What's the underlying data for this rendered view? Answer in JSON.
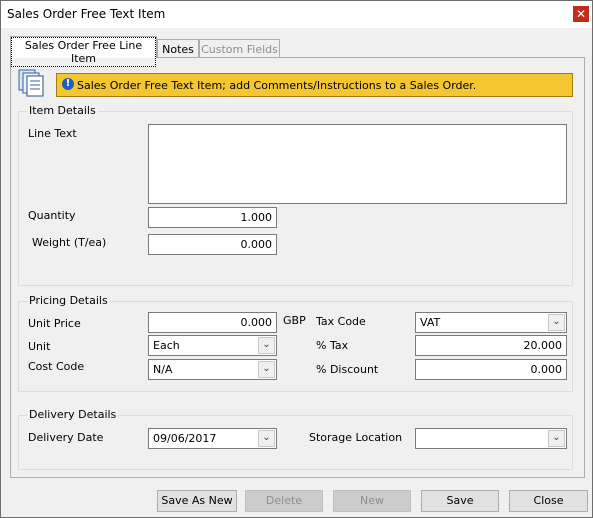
{
  "window": {
    "title": "Sales Order Free Text Item"
  },
  "tabs": [
    {
      "label": "Sales Order Free Line Item"
    },
    {
      "label": "Notes"
    },
    {
      "label": "Custom Fields"
    }
  ],
  "banner": {
    "text": "Sales Order Free Text Item; add Comments/Instructions to a Sales Order."
  },
  "item_details": {
    "title": "Item Details",
    "line_text_label": "Line Text",
    "line_text_value": "",
    "quantity_label": "Quantity",
    "quantity_value": "1.000",
    "weight_label": "Weight (T/ea)",
    "weight_value": "0.000"
  },
  "pricing_details": {
    "title": "Pricing Details",
    "unit_price_label": "Unit Price",
    "unit_price_value": "0.000",
    "currency": "GBP",
    "unit_label": "Unit",
    "unit_value": "Each",
    "cost_code_label": "Cost Code",
    "cost_code_value": "N/A",
    "tax_code_label": "Tax Code",
    "tax_code_value": "VAT",
    "tax_pct_label": "% Tax",
    "tax_pct_value": "20.000",
    "discount_label": "% Discount",
    "discount_value": "0.000"
  },
  "delivery_details": {
    "title": "Delivery Details",
    "delivery_date_label": "Delivery Date",
    "delivery_date_value": "09/06/2017",
    "storage_location_label": "Storage Location",
    "storage_location_value": ""
  },
  "buttons": {
    "save_as_new": "Save As New",
    "delete": "Delete",
    "new": "New",
    "save": "Save",
    "close": "Close"
  },
  "icons": {
    "close": "✕",
    "dropdown": "⌄",
    "info": "!"
  },
  "colors": {
    "banner_bg": "#f4c632",
    "close_bg": "#c42b1c"
  }
}
